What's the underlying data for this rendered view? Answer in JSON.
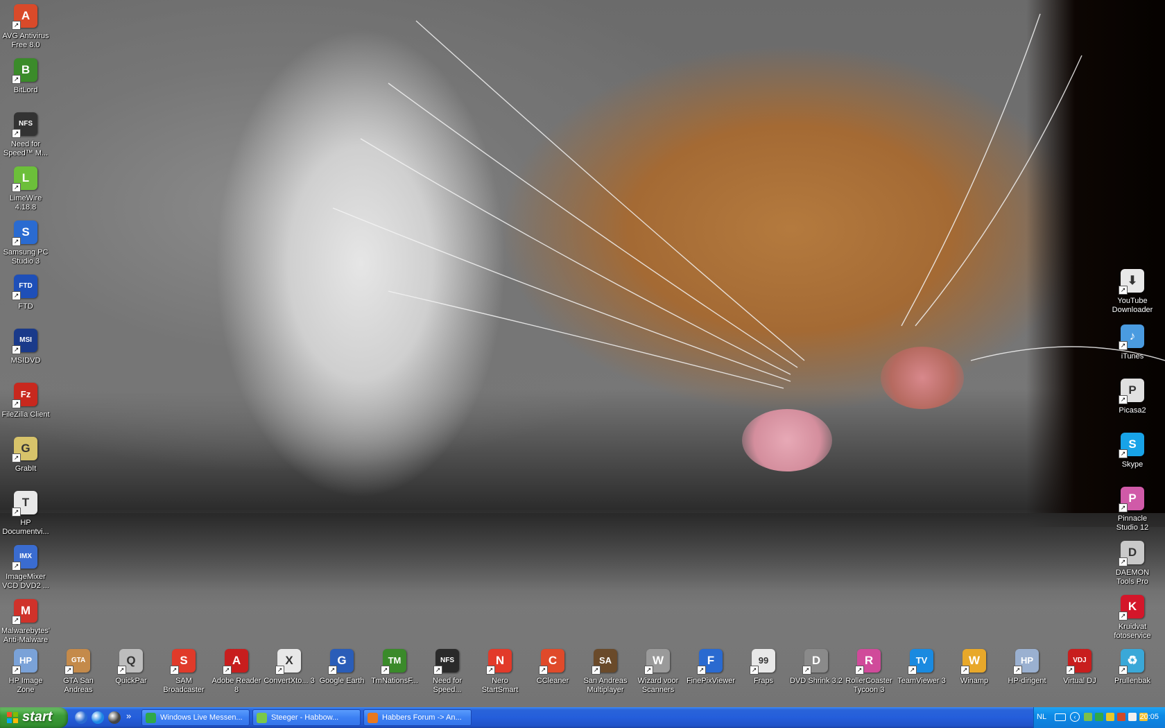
{
  "desktop": {
    "icons_left": [
      {
        "label": "AVG Antivirus Free 8.0",
        "icon": "avg-shield-icon",
        "color": "#d94a2a",
        "glyph": "A"
      },
      {
        "label": "BitLord",
        "icon": "bitlord-icon",
        "color": "#3b8b2a",
        "glyph": "B"
      },
      {
        "label": "Need for Speed™ M...",
        "icon": "nfs-icon",
        "color": "#333333",
        "glyph": "NFS"
      },
      {
        "label": "LimeWire 4.18.8",
        "icon": "limewire-icon",
        "color": "#6cbf3a",
        "glyph": "L"
      },
      {
        "label": "Samsung PC Studio 3",
        "icon": "samsung-icon",
        "color": "#2a6bd1",
        "glyph": "S"
      },
      {
        "label": "FTD",
        "icon": "ftd-icon",
        "color": "#1e4fb8",
        "glyph": "FTD"
      },
      {
        "label": "MSIDVD",
        "icon": "msi-icon",
        "color": "#1a3a8a",
        "glyph": "MSI"
      },
      {
        "label": "FileZilla Client",
        "icon": "filezilla-icon",
        "color": "#c8281e",
        "glyph": "Fz"
      },
      {
        "label": "GrabIt",
        "icon": "grabit-icon",
        "color": "#d7c36a",
        "glyph": "G"
      },
      {
        "label": "HP Documentvi...",
        "icon": "hp-document-icon",
        "color": "#e8e8e8",
        "glyph": "T"
      },
      {
        "label": "ImageMixer VCD DVD2 ...",
        "icon": "imagemixer-icon",
        "color": "#3a6cd0",
        "glyph": "IMX"
      },
      {
        "label": "Malwarebytes' Anti-Malware",
        "icon": "malwarebytes-icon",
        "color": "#d0322a",
        "glyph": "M"
      }
    ],
    "icons_right": [
      {
        "label": "YouTube Downloader",
        "icon": "youtube-downloader-icon",
        "color": "#e8e8e8",
        "glyph": "⬇"
      },
      {
        "label": "iTunes",
        "icon": "itunes-icon",
        "color": "#4a9be0",
        "glyph": "♪"
      },
      {
        "label": "Picasa2",
        "icon": "picasa-icon",
        "color": "#e0e0e0",
        "glyph": "P"
      },
      {
        "label": "Skype",
        "icon": "skype-icon",
        "color": "#18a3e8",
        "glyph": "S"
      },
      {
        "label": "Pinnacle Studio 12",
        "icon": "pinnacle-icon",
        "color": "#d05aa8",
        "glyph": "P"
      },
      {
        "label": "DAEMON Tools Pro",
        "icon": "daemon-tools-icon",
        "color": "#c9c9c9",
        "glyph": "D"
      },
      {
        "label": "Kruidvat fotoservice",
        "icon": "kruidvat-icon",
        "color": "#d4162a",
        "glyph": "K"
      }
    ],
    "icons_bottom": [
      {
        "label": "HP Image Zone",
        "icon": "hp-image-zone-icon",
        "color": "#7aa2d8",
        "glyph": "HP"
      },
      {
        "label": "GTA San Andreas",
        "icon": "gta-icon",
        "color": "#c48a4a",
        "glyph": "GTA"
      },
      {
        "label": "QuickPar",
        "icon": "quickpar-icon",
        "color": "#bdbdbd",
        "glyph": "Q"
      },
      {
        "label": "SAM Broadcaster",
        "icon": "sam-broadcaster-icon",
        "color": "#e03a2a",
        "glyph": "S"
      },
      {
        "label": "Adobe Reader 8",
        "icon": "adobe-reader-icon",
        "color": "#c81e1e",
        "glyph": "A"
      },
      {
        "label": "ConvertXto... 3",
        "icon": "convertx-icon",
        "color": "#e8e8e8",
        "glyph": "X"
      },
      {
        "label": "Google Earth",
        "icon": "google-earth-icon",
        "color": "#2a5db8",
        "glyph": "G"
      },
      {
        "label": "TmNationsF...",
        "icon": "trackmania-icon",
        "color": "#3a8a2a",
        "glyph": "TM"
      },
      {
        "label": "Need for Speed...",
        "icon": "nfs-icon",
        "color": "#2a2a2a",
        "glyph": "NFS"
      },
      {
        "label": "Nero StartSmart",
        "icon": "nero-icon",
        "color": "#e23a2a",
        "glyph": "N"
      },
      {
        "label": "CCleaner",
        "icon": "ccleaner-icon",
        "color": "#e04a2a",
        "glyph": "C"
      },
      {
        "label": "San Andreas Multiplayer",
        "icon": "samp-icon",
        "color": "#6a4a2a",
        "glyph": "SA"
      },
      {
        "label": "Wizard voor Scanners",
        "icon": "scanner-icon",
        "color": "#9a9a9a",
        "glyph": "W"
      },
      {
        "label": "FinePixViewer",
        "icon": "finepix-icon",
        "color": "#2a6ad0",
        "glyph": "F"
      },
      {
        "label": "Fraps",
        "icon": "fraps-icon",
        "color": "#e8e8e8",
        "glyph": "99"
      },
      {
        "label": "DVD Shrink 3.2",
        "icon": "dvd-shrink-icon",
        "color": "#8a8a8a",
        "glyph": "D"
      },
      {
        "label": "RollerCoaster Tycoon 3",
        "icon": "rollercoaster-icon",
        "color": "#d04a9a",
        "glyph": "R"
      },
      {
        "label": "TeamViewer 3",
        "icon": "teamviewer-icon",
        "color": "#1a8ae0",
        "glyph": "TV"
      },
      {
        "label": "Winamp",
        "icon": "winamp-icon",
        "color": "#e8a82a",
        "glyph": "W"
      },
      {
        "label": "HP-dirigent",
        "icon": "hp-dirigent-icon",
        "color": "#9ab0d0",
        "glyph": "HP"
      },
      {
        "label": "Virtual DJ",
        "icon": "virtual-dj-icon",
        "color": "#c81e1e",
        "glyph": "VDJ"
      },
      {
        "label": "Prullenbak",
        "icon": "recycle-bin-icon",
        "color": "#3aa8d8",
        "glyph": "♻"
      }
    ]
  },
  "taskbar": {
    "start_label": "start",
    "quick_launch": [
      {
        "icon": "show-desktop-icon",
        "color": "#2a6bd1"
      },
      {
        "icon": "internet-explorer-icon",
        "color": "#1e88e5"
      },
      {
        "icon": "avg-shield-icon",
        "color": "#444444"
      }
    ],
    "quick_launch_more": "»",
    "tasks": [
      {
        "label": "Windows Live Messen...",
        "icon": "messenger-icon",
        "color": "#2fa84a"
      },
      {
        "label": "Steeger - Habbow...",
        "icon": "messenger-chat-icon",
        "color": "#7ac84a"
      },
      {
        "label": "Habbers Forum -> An...",
        "icon": "firefox-icon",
        "color": "#e8781e"
      }
    ],
    "tray": {
      "language": "NL",
      "icons": [
        {
          "icon": "network-icon",
          "color": "#7cc04a"
        },
        {
          "icon": "messenger-tray-icon",
          "color": "#2fa84a"
        },
        {
          "icon": "avg-tray-icon",
          "color": "#e8c82a"
        },
        {
          "icon": "security-icon",
          "color": "#d04a2a"
        },
        {
          "icon": "volume-icon",
          "color": "#f0f0f0"
        },
        {
          "icon": "update-icon",
          "color": "#f0c030"
        }
      ],
      "clock": "20:05"
    }
  }
}
